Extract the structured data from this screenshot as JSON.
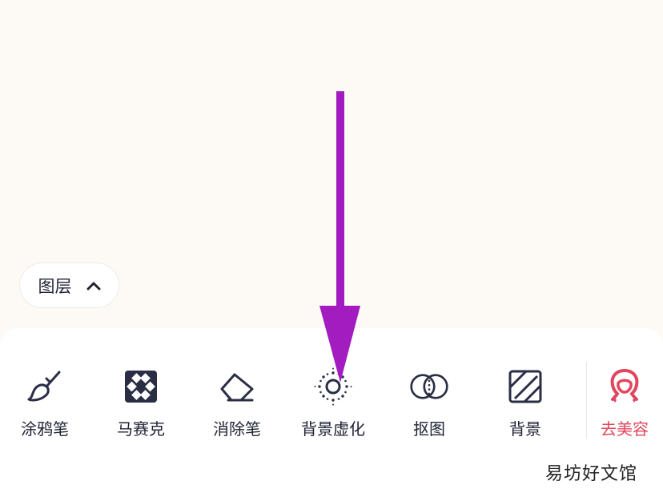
{
  "layer_button": {
    "label": "图层",
    "chevron_icon": "chevron-up-icon"
  },
  "toolbar": {
    "tools": [
      {
        "label": "涂鸦笔",
        "icon": "brush-icon"
      },
      {
        "label": "马赛克",
        "icon": "mosaic-icon"
      },
      {
        "label": "消除笔",
        "icon": "eraser-icon"
      },
      {
        "label": "背景虚化",
        "icon": "background-blur-icon"
      },
      {
        "label": "抠图",
        "icon": "cutout-icon"
      },
      {
        "label": "背景",
        "icon": "background-icon"
      },
      {
        "label": "去美容",
        "icon": "beauty-icon"
      }
    ]
  },
  "watermark": "易坊好文馆",
  "colors": {
    "accent_arrow": "#a21cc0",
    "beauty_accent": "#e0475e",
    "icon_dark": "#2a2e44",
    "canvas_bg": "#fdfaf6"
  }
}
